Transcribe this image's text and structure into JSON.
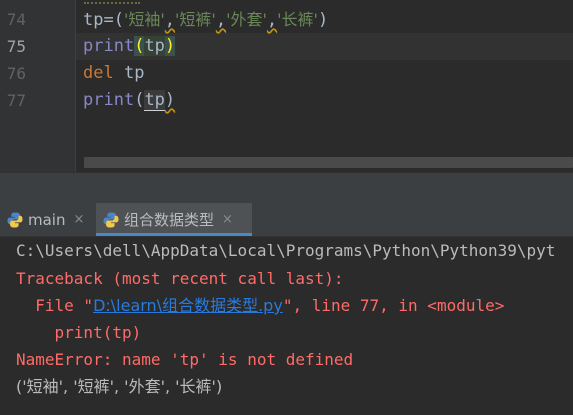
{
  "editor": {
    "lines": [
      {
        "number": "74",
        "tokens": [
          "tp",
          "=(",
          "'短袖'",
          ",",
          "'短裤'",
          ",",
          "'外套'",
          ",",
          "'长裤'",
          ")"
        ]
      },
      {
        "number": "75",
        "tokens": [
          "print",
          "(",
          "tp",
          ")"
        ]
      },
      {
        "number": "76",
        "tokens": [
          "del",
          " ",
          "tp"
        ]
      },
      {
        "number": "77",
        "tokens": [
          "print",
          "(",
          "tp",
          ")"
        ]
      }
    ]
  },
  "run_panel": {
    "tabs": [
      {
        "label": "main",
        "close": "×",
        "active": false
      },
      {
        "label": "组合数据类型",
        "close": "×",
        "active": true
      }
    ]
  },
  "console": {
    "command": "C:\\Users\\dell\\AppData\\Local\\Programs\\Python\\Python39\\pyt",
    "traceback_header": "Traceback (most recent call last):",
    "file_prefix": "  File \"",
    "file_link": "D:\\learn\\组合数据类型.py",
    "file_suffix": "\", line 77, in <module>",
    "code_line": "    print(tp)",
    "error_line": "NameError: name 'tp' is not defined",
    "output_line": "('短袖', '短裤', '外套', '长裤')"
  },
  "colors": {
    "editor_bg": "#2b2b2b",
    "gutter_bg": "#313335",
    "keyword": "#cc7832",
    "builtin": "#8888c6",
    "string": "#6a8759",
    "error": "#ff6b68",
    "link": "#287bde",
    "active_tab_underline": "#4a88c7"
  }
}
